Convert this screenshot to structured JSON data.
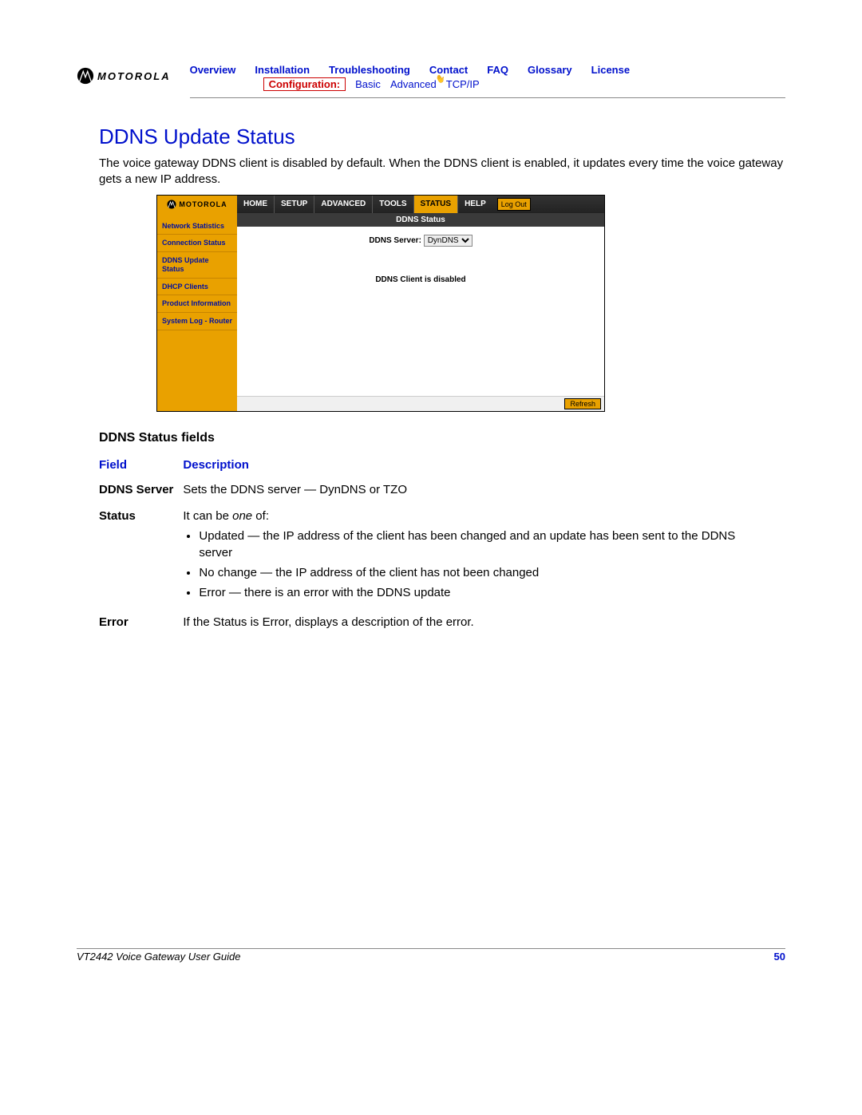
{
  "brand": "MOTOROLA",
  "top_nav": {
    "overview": "Overview",
    "installation": "Installation",
    "troubleshooting": "Troubleshooting",
    "contact": "Contact",
    "faq": "FAQ",
    "glossary": "Glossary",
    "license": "License"
  },
  "sub_nav": {
    "label": "Configuration:",
    "basic": "Basic",
    "advanced": "Advanced",
    "tcpip": "TCP/IP"
  },
  "section_title": "DDNS Update Status",
  "body_text": "The voice gateway DDNS client is disabled by default. When the DDNS client is enabled, it updates every time the voice gateway gets a new IP address.",
  "screenshot": {
    "brand": "MOTOROLA",
    "tabs": {
      "home": "HOME",
      "setup": "SETUP",
      "advanced": "ADVANCED",
      "tools": "TOOLS",
      "status": "STATUS",
      "help": "HELP"
    },
    "logout": "Log Out",
    "sidebar": {
      "network_stats": "Network Statistics",
      "conn_status": "Connection Status",
      "ddns_update": "DDNS Update Status",
      "dhcp_clients": "DHCP Clients",
      "product_info": "Product Information",
      "syslog_router": "System Log - Router"
    },
    "panel_title": "DDNS Status",
    "field_label": "DDNS Server:",
    "field_value": "DynDNS",
    "message": "DDNS Client is disabled",
    "refresh": "Refresh"
  },
  "table": {
    "heading": "DDNS Status fields",
    "col_field": "Field",
    "col_desc": "Description",
    "rows": {
      "ddns_server": {
        "name": "DDNS Server",
        "desc": "Sets the DDNS server — DynDNS or TZO"
      },
      "status": {
        "name": "Status",
        "lead": "It can be ",
        "lead_em": "one",
        "lead_tail": " of:",
        "b1": "Updated — the IP address of the client has been changed and an update has been sent to the DDNS server",
        "b2": "No change — the IP address of the client has not been changed",
        "b3": "Error — there is an error with the DDNS update"
      },
      "error": {
        "name": "Error",
        "desc": "If the Status is Error, displays a description of the error."
      }
    }
  },
  "footer": {
    "guide": "VT2442 Voice Gateway User Guide",
    "page": "50"
  }
}
